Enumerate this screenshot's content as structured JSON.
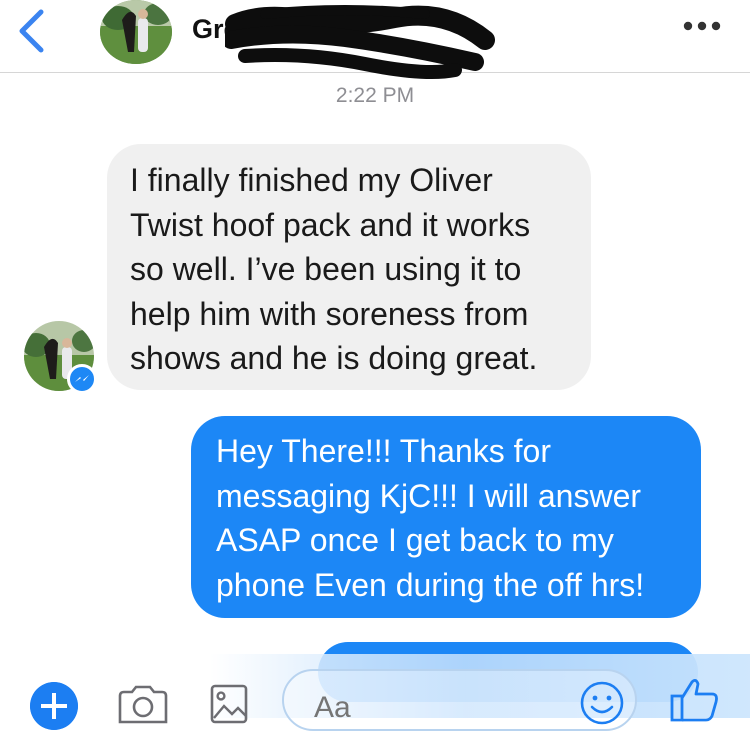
{
  "header": {
    "contact_name": "Gre",
    "back_icon": "chevron-left-icon",
    "more_icon": "more-horizontal-icon",
    "accent_color": "#3b84f0"
  },
  "thread": {
    "timestamp": "2:22 PM",
    "messages": [
      {
        "direction": "incoming",
        "lines": [
          "I finally finished my Oliver",
          "Twist hoof pack and it works",
          "so well. I’ve been using it to",
          "help him with soreness from",
          "shows and he is doing great."
        ]
      },
      {
        "direction": "outgoing",
        "lines": [
          "Hey There!!! Thanks for",
          "messaging KjC!!! I will answer",
          "ASAP once I get back to my",
          "phone Even during the off hrs!"
        ]
      }
    ],
    "incoming_color": "#f0f0f0",
    "outgoing_color": "#1c87f6"
  },
  "composer": {
    "placeholder": "Aa",
    "icons": [
      "plus-icon",
      "camera-icon",
      "photo-icon",
      "emoji-icon",
      "thumbs-up-icon"
    ]
  }
}
